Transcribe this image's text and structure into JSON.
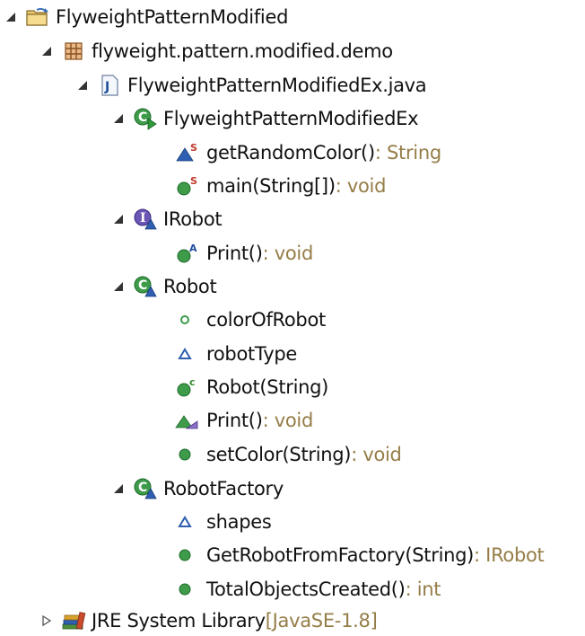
{
  "tree": {
    "project": {
      "label": "FlyweightPatternModified",
      "icon": "java-project-icon"
    },
    "package": {
      "label": "flyweight.pattern.modified.demo",
      "icon": "package-icon"
    },
    "file": {
      "label": "FlyweightPatternModifiedEx.java",
      "icon": "java-file-icon"
    },
    "class_main": {
      "label": "FlyweightPatternModifiedEx",
      "icon": "class-runnable-icon",
      "members": [
        {
          "name": "getRandomColor()",
          "type": " : String",
          "icon": "static-default-method-icon"
        },
        {
          "name": "main(String[])",
          "type": " : void",
          "icon": "static-public-method-icon"
        }
      ]
    },
    "interface_irobot": {
      "label": "IRobot",
      "icon": "interface-default-icon",
      "members": [
        {
          "name": "Print()",
          "type": " : void",
          "icon": "abstract-public-method-icon"
        }
      ]
    },
    "class_robot": {
      "label": "Robot",
      "icon": "class-default-icon",
      "members": [
        {
          "name": "colorOfRobot",
          "type": "",
          "icon": "field-public-icon"
        },
        {
          "name": "robotType",
          "type": "",
          "icon": "field-default-icon"
        },
        {
          "name": "Robot(String)",
          "type": "",
          "icon": "constructor-icon"
        },
        {
          "name": "Print()",
          "type": " : void",
          "icon": "override-default-method-icon"
        },
        {
          "name": "setColor(String)",
          "type": " : void",
          "icon": "public-method-icon"
        }
      ]
    },
    "class_factory": {
      "label": "RobotFactory",
      "icon": "class-default-icon",
      "members": [
        {
          "name": "shapes",
          "type": "",
          "icon": "field-default-icon"
        },
        {
          "name": "GetRobotFromFactory(String)",
          "type": " : IRobot",
          "icon": "public-method-icon"
        },
        {
          "name": "TotalObjectsCreated()",
          "type": " : int",
          "icon": "public-method-icon"
        }
      ]
    },
    "jre": {
      "label": "JRE System Library",
      "qualifier": " [JavaSE-1.8]",
      "icon": "library-icon"
    }
  }
}
